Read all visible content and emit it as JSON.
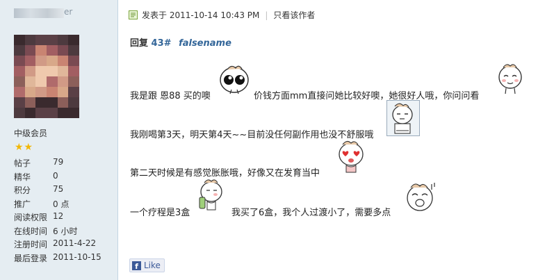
{
  "sidebar": {
    "username_suffix": "er",
    "rank": "中级会员",
    "stars": "★★",
    "stats": [
      {
        "label": "帖子",
        "value": "79"
      },
      {
        "label": "精华",
        "value": "0"
      },
      {
        "label": "积分",
        "value": "75"
      },
      {
        "label": "推广",
        "value": "0 点"
      },
      {
        "label": "阅读权限",
        "value": "12"
      },
      {
        "label": "在线时间",
        "value": "6 小时"
      },
      {
        "label": "注册时间",
        "value": "2011-4-22"
      },
      {
        "label": "最后登录",
        "value": "2011-10-15"
      }
    ]
  },
  "post": {
    "posted_at": "发表于 2011-10-14 10:43 PM",
    "author_only_link": "只看该作者",
    "reply_prefix": "回复",
    "reply_number": "43#",
    "reply_to": "falsename",
    "lines": [
      {
        "a": "我是跟 恩88 买的噢",
        "b": "价钱方面mm直接问她比较好噢，她很好人哦，你问问看"
      },
      {
        "a": "我刚喝第3天，明天第4天~~目前没任何副作用也没不舒服哦"
      },
      {
        "a": "第二天时候是有感觉胀胀哦，好像又在发育当中"
      },
      {
        "a": "一个疗程是3盒",
        "b": "我买了6盒，我个人过渡小了，需要多点"
      }
    ],
    "like_label": "Like"
  },
  "icons": {
    "post_icon": "post-icon",
    "facebook": "facebook-icon",
    "emoticons": [
      "emoticon-big-eyes",
      "emoticon-smile",
      "emoticon-thinking",
      "emoticon-heart-eyes",
      "emoticon-drinking",
      "emoticon-laughing"
    ]
  }
}
